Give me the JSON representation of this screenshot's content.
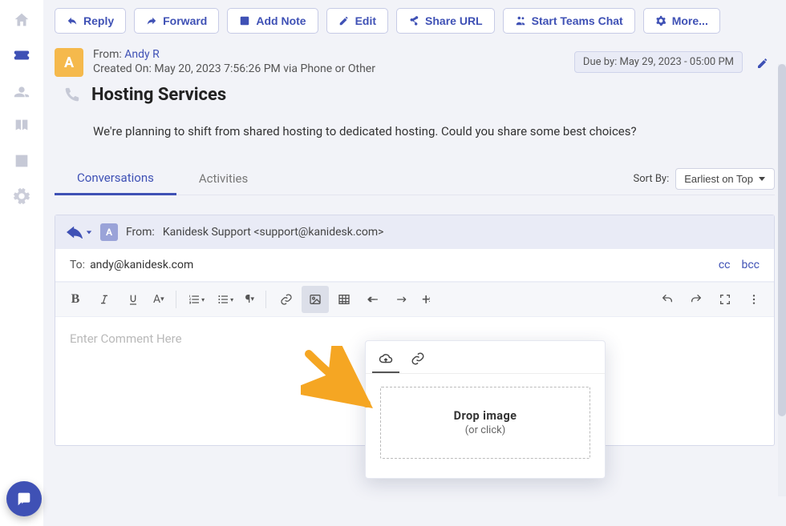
{
  "sidebar": {
    "items": [
      {
        "name": "home"
      },
      {
        "name": "tickets"
      },
      {
        "name": "contacts"
      },
      {
        "name": "knowledge-base"
      },
      {
        "name": "reports"
      },
      {
        "name": "settings"
      }
    ]
  },
  "actions": {
    "reply": "Reply",
    "forward": "Forward",
    "add_note": "Add Note",
    "edit": "Edit",
    "share_url": "Share URL",
    "start_teams": "Start Teams Chat",
    "more": "More..."
  },
  "ticket": {
    "avatar_initial": "A",
    "from_label": "From: ",
    "from_name": "Andy R",
    "created_label": "Created On: ",
    "created_value": "May 20, 2023 7:56:26 PM via Phone or Other",
    "due_label": "Due by: ",
    "due_value": "May 29, 2023 - 05:00 PM",
    "subject": "Hosting Services",
    "body": "We're planning to shift from shared hosting to dedicated hosting. Could you share some best choices?"
  },
  "tabs": {
    "conversations": "Conversations",
    "activities": "Activities",
    "sort_label": "Sort By:",
    "sort_value": "Earliest on Top"
  },
  "composer": {
    "avatar_initial": "A",
    "from_label": "From:",
    "from_value": "Kanidesk Support <support@kanidesk.com>",
    "to_label": "To:",
    "to_value": "andy@kanidesk.com",
    "cc": "cc",
    "bcc": "bcc",
    "placeholder": "Enter Comment Here"
  },
  "popover": {
    "drop_title": "Drop image",
    "drop_sub": "(or click)"
  }
}
